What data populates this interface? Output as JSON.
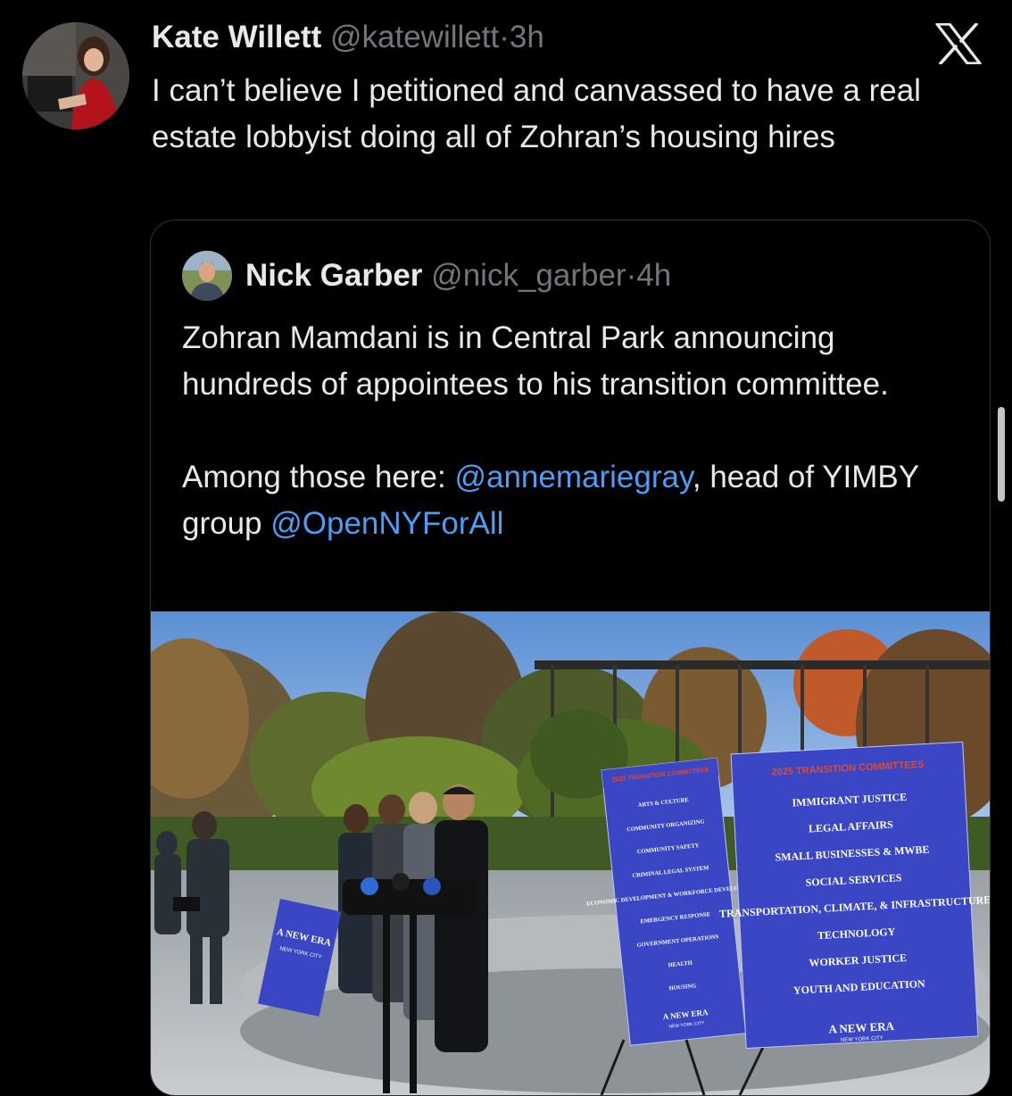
{
  "tweet": {
    "author_name": "Kate Willett",
    "author_handle": "@katewillett",
    "separator": "·",
    "time": "3h",
    "text": "I can’t believe I petitioned and canvassed to have a real estate lobbyist doing all of Zohran’s housing hires",
    "avatar_icon": "profile-photo"
  },
  "quote": {
    "author_name": "Nick Garber",
    "author_handle": "@nick_garber",
    "separator": "·",
    "time": "4h",
    "paragraph1": "Zohran Mamdani is in Central Park announcing hundreds of appointees to his transition committee.",
    "paragraph2_prefix": "Among those here: ",
    "mention1": "@annemariegray",
    "paragraph2_mid": ", head of YIMBY group ",
    "mention2": "@OpenNYForAll"
  },
  "photo": {
    "left_sign": {
      "title": "2025 TRANSITION COMMITTEES",
      "items": [
        "ARTS & CULTURE",
        "COMMUNITY ORGANIZING",
        "COMMUNITY SAFETY",
        "CRIMINAL LEGAL SYSTEM",
        "ECONOMIC DEVELOPMENT & WORKFORCE DEVELOPMENT",
        "EMERGENCY RESPONSE",
        "GOVERNMENT OPERATIONS",
        "HEALTH",
        "HOUSING"
      ],
      "footer": "A NEW ERA",
      "footer_sub": "NEW YORK CITY"
    },
    "right_sign": {
      "title": "2025 TRANSITION COMMITTEES",
      "items": [
        "IMMIGRANT JUSTICE",
        "LEGAL AFFAIRS",
        "SMALL BUSINESSES & MWBE",
        "SOCIAL SERVICES",
        "TRANSPORTATION, CLIMATE, & INFRASTRUCTURE",
        "TECHNOLOGY",
        "WORKER JUSTICE",
        "YOUTH AND EDUCATION"
      ],
      "footer": "A NEW ERA",
      "footer_sub": "NEW YORK CITY"
    },
    "podium_sign": {
      "title": "A NEW ERA",
      "sub": "NEW YORK CITY"
    }
  },
  "colors": {
    "background": "#000000",
    "text": "#e7e9ea",
    "muted": "#71767b",
    "link": "#4b9df5",
    "border": "#2f3336",
    "sign_blue": "#3a46c4",
    "sign_red": "#e04a2f"
  },
  "icons": {
    "close": "x-logo-icon"
  }
}
